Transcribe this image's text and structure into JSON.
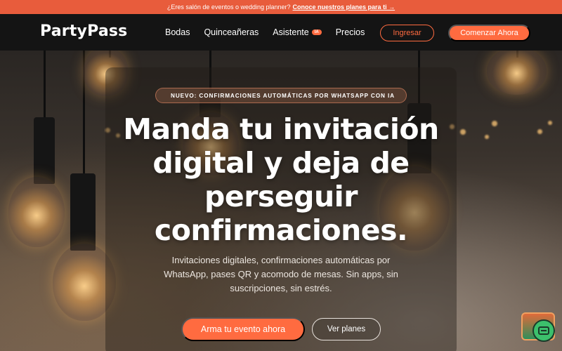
{
  "announcement": {
    "text": "¿Eres salón de eventos o wedding planner?",
    "link_label": "Conoce nuestros planes para ti →"
  },
  "nav": {
    "logo": "PartyPass",
    "items": [
      {
        "label": "Bodas"
      },
      {
        "label": "Quinceañeras"
      },
      {
        "label": "Asistente",
        "badge": "IA"
      },
      {
        "label": "Precios"
      }
    ],
    "login_label": "Ingresar",
    "cta_label": "Comenzar Ahora"
  },
  "hero": {
    "pill_icon": "",
    "pill_text": "NUEVO: CONFIRMACIONES AUTOMÁTICAS POR WHATSAPP CON IA",
    "headline": "Manda tu invitación digital y deja de perseguir confirmaciones.",
    "subtitle": "Invitaciones digitales, confirmaciones automáticas por WhatsApp, pases QR y acomodo de mesas. Sin apps, sin suscripciones, sin estrés.",
    "primary_cta": "Arma tu evento ahora",
    "secondary_cta": "Ver planes"
  },
  "colors": {
    "accent": "#ff6b40",
    "nav_background": "#141414",
    "announcement_background": "#e85c3c",
    "chat_green": "#3cc06c"
  },
  "icons": {
    "chat_widget": "chat-icon"
  }
}
